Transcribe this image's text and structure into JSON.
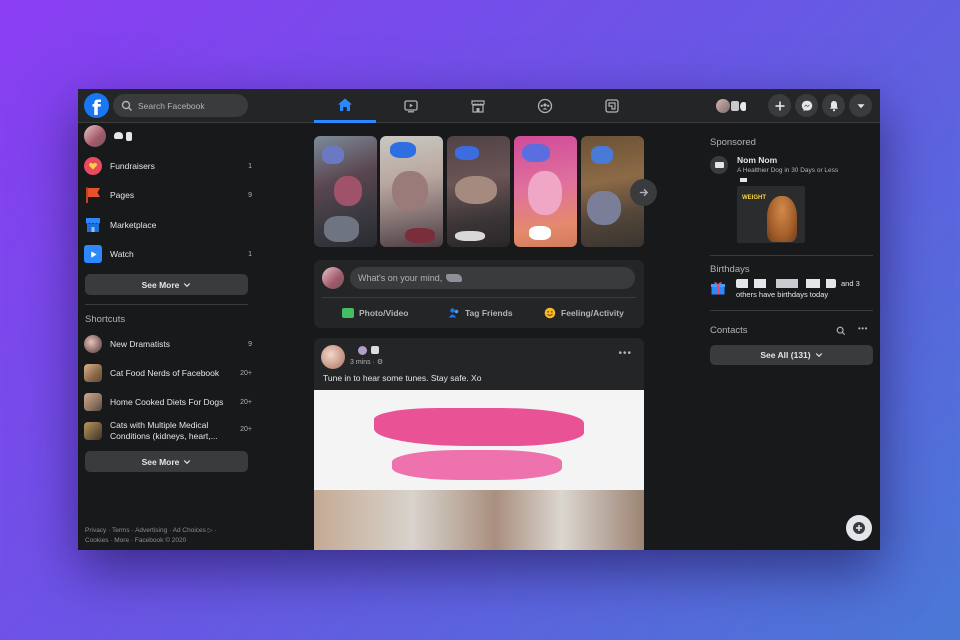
{
  "search": {
    "placeholder": "Search Facebook"
  },
  "left_nav": {
    "items": [
      {
        "label": "Fundraisers",
        "count": "1",
        "icon": "heart-coin-icon",
        "color": "#e84a5f"
      },
      {
        "label": "Pages",
        "count": "9",
        "icon": "flag-icon",
        "color": "#e8512b"
      },
      {
        "label": "Marketplace",
        "count": "",
        "icon": "shop-icon",
        "color": "#2d88ff"
      },
      {
        "label": "Watch",
        "count": "1",
        "icon": "play-icon",
        "color": "#2d88ff"
      }
    ],
    "see_more": "See More"
  },
  "shortcuts": {
    "title": "Shortcuts",
    "items": [
      {
        "label": "New Dramatists",
        "count": "9"
      },
      {
        "label": "Cat Food Nerds of Facebook",
        "count": "20+"
      },
      {
        "label": "Home Cooked Diets For Dogs",
        "count": "20+"
      },
      {
        "label": "Cats with Multiple Medical Conditions (kidneys, heart,...",
        "count": "20+"
      }
    ],
    "see_more": "See More"
  },
  "footer": {
    "line1": "Privacy · Terms · Advertising · Ad Choices ▷ ·",
    "line2": "Cookies · More · Facebook © 2020"
  },
  "composer": {
    "placeholder": "What's on your mind,",
    "actions": [
      {
        "label": "Photo/Video",
        "icon": "photo-icon",
        "color": "#45bd62"
      },
      {
        "label": "Tag Friends",
        "icon": "tag-friends-icon",
        "color": "#1877f2"
      },
      {
        "label": "Feeling/Activity",
        "icon": "smile-icon",
        "color": "#f7b928"
      }
    ]
  },
  "post": {
    "time": "3 mins · ⚙",
    "text": "Tune in to hear some tunes. Stay safe. Xo"
  },
  "sponsored": {
    "title": "Sponsored",
    "name": "Nom Nom",
    "tagline": "A Healthier Dog in 30 Days or Less",
    "image_text": "WEIGHT"
  },
  "birthdays": {
    "title": "Birthdays",
    "line1_tail": "and 3",
    "line2": "others have birthdays today"
  },
  "contacts": {
    "title": "Contacts",
    "see_all": "See All (131)"
  },
  "colors": {
    "accent": "#2d88ff",
    "brand": "#1877f2",
    "surface": "#242526",
    "background": "#18191a"
  }
}
